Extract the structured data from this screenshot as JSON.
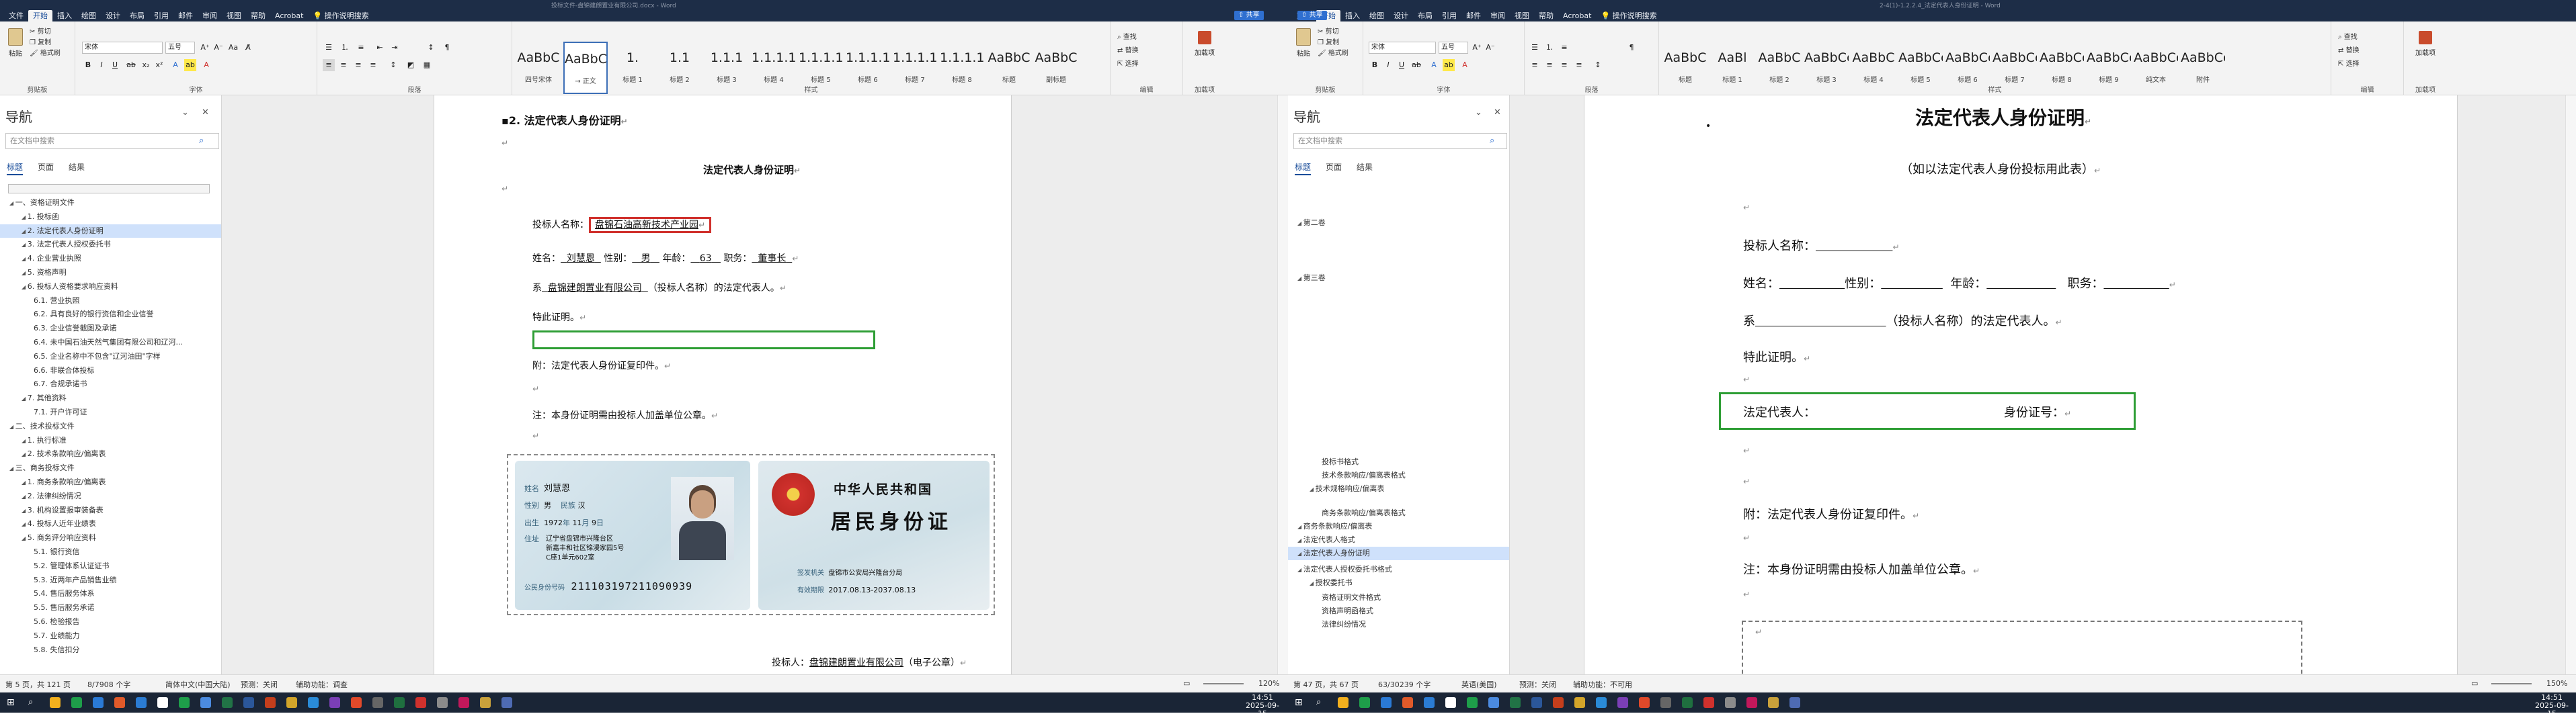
{
  "left_window": {
    "title_text": "投标文件-盘锦建朗置业有限公司.docx  -  Word",
    "ribbon_tabs": [
      "文件",
      "开始",
      "插入",
      "绘图",
      "设计",
      "布局",
      "引用",
      "邮件",
      "审阅",
      "视图",
      "帮助",
      "Acrobat",
      "操作说明搜索"
    ],
    "share_label": "共享",
    "ribbon": {
      "clipboard": {
        "paste": "粘贴",
        "cut": "剪切",
        "copy": "复制",
        "format_painter": "格式刷",
        "group": "剪贴板"
      },
      "font": {
        "name": "宋体",
        "size": "五号",
        "group": "字体"
      },
      "paragraph": {
        "group": "段落"
      },
      "styles": {
        "group": "样式",
        "items": [
          {
            "preview": "AaBbC",
            "name": "四号宋体"
          },
          {
            "preview": "AaBbCcD",
            "name": "→ 正文"
          },
          {
            "preview": "1.",
            "name": "标题 1"
          },
          {
            "preview": "1.1",
            "name": "标题 2"
          },
          {
            "preview": "1.1.1",
            "name": "标题 3"
          },
          {
            "preview": "1.1.1.1",
            "name": "标题 4"
          },
          {
            "preview": "1.1.1.1.1",
            "name": "标题 5"
          },
          {
            "preview": "1.1.1.1.1.",
            "name": "标题 6"
          },
          {
            "preview": "1.1.1.1.1",
            "name": "标题 7"
          },
          {
            "preview": "1.1.1.1.",
            "name": "标题 8"
          },
          {
            "preview": "AaBbC",
            "name": "标题"
          },
          {
            "preview": "AaBbC",
            "name": "副标题"
          }
        ]
      },
      "editing": {
        "find": "查找",
        "replace": "替换",
        "select": "选择",
        "group": "编辑"
      },
      "addins": {
        "label": "加载项",
        "group": "加载项"
      }
    },
    "nav": {
      "title": "导航",
      "search_placeholder": "在文档中搜索",
      "tabs": [
        "标题",
        "页面",
        "结果"
      ],
      "items": [
        {
          "text": "一、资格证明文件",
          "level": 0
        },
        {
          "text": "1. 投标函",
          "level": 1
        },
        {
          "text": "2. 法定代表人身份证明",
          "level": 1,
          "selected": true
        },
        {
          "text": "3. 法定代表人授权委托书",
          "level": 1
        },
        {
          "text": "4. 企业营业执照",
          "level": 1
        },
        {
          "text": "5. 资格声明",
          "level": 1
        },
        {
          "text": "6. 投标人资格要求响应资料",
          "level": 1
        },
        {
          "text": "6.1. 营业执照",
          "level": 2
        },
        {
          "text": "6.2. 具有良好的银行资信和企业信誉",
          "level": 2
        },
        {
          "text": "6.3. 企业信誉截图及承诺",
          "level": 2
        },
        {
          "text": "6.4. 未中国石油天然气集团有限公司和辽河...",
          "level": 2
        },
        {
          "text": "6.5. 企业名称中不包含\"辽河油田\"字样",
          "level": 2
        },
        {
          "text": "6.6. 非联合体投标",
          "level": 2
        },
        {
          "text": "6.7. 合规承诺书",
          "level": 2
        },
        {
          "text": "7. 其他资料",
          "level": 1
        },
        {
          "text": "7.1. 开户许可证",
          "level": 2
        },
        {
          "text": "二、技术投标文件",
          "level": 0
        },
        {
          "text": "1. 执行标准",
          "level": 1
        },
        {
          "text": "2. 技术条款响应/偏离表",
          "level": 1
        },
        {
          "text": "三、商务投标文件",
          "level": 0
        },
        {
          "text": "1. 商务条款响应/偏离表",
          "level": 1
        },
        {
          "text": "2. 法律纠纷情况",
          "level": 1
        },
        {
          "text": "3. 机构设置报审装备表",
          "level": 1
        },
        {
          "text": "4. 投标人近年业绩表",
          "level": 1
        },
        {
          "text": "5. 商务评分响应资料",
          "level": 1
        },
        {
          "text": "5.1. 银行资信",
          "level": 2
        },
        {
          "text": "5.2. 管理体系认证证书",
          "level": 2
        },
        {
          "text": "5.3. 近两年产品销售业绩",
          "level": 2
        },
        {
          "text": "5.4. 售后服务体系",
          "level": 2
        },
        {
          "text": "5.5. 售后服务承诺",
          "level": 2
        },
        {
          "text": "5.6. 检验报告",
          "level": 2
        },
        {
          "text": "5.7. 业绩能力",
          "level": 2
        },
        {
          "text": "5.8. 失信扣分",
          "level": 2
        }
      ]
    },
    "doc": {
      "heading": "2. 法定代表人身份证明",
      "title": "法定代表人身份证明",
      "bidder_label": "投标人名称：",
      "bidder_value": "盘锦石油高新技术产业园",
      "name_label": "姓名：",
      "name_value": "刘慧恩",
      "gender_label": "性别：",
      "gender_value": "男",
      "age_label": "年龄：",
      "age_value": "63",
      "position_label": "职务：",
      "position_value": "董事长",
      "of_prefix": "系",
      "company_value": "盘锦建朗置业有限公司",
      "of_suffix": "（投标人名称）的法定代表人。",
      "certify": "特此证明。",
      "attachment": "附：法定代表人身份证复印件。",
      "note": "注：本身份证明需由投标人加盖单位公章。",
      "signature_label": "投标人：",
      "signature_value": "盘锦建朗置业有限公司",
      "signature_suffix": "（电子公章）"
    },
    "id_card": {
      "front": {
        "name_label": "姓名",
        "name": "刘慧恩",
        "gender_label": "性别",
        "gender": "男",
        "ethnic_label": "民族",
        "ethnic": "汉",
        "birth_label": "出生",
        "birth_year": "1972",
        "birth_month": "11",
        "birth_day": "9",
        "year_unit": "年",
        "month_unit": "月",
        "day_unit": "日",
        "address_label": "住址",
        "address_l1": "辽宁省盘锦市兴隆台区",
        "address_l2": "新嘉丰和社区锦漫家园5号",
        "address_l3": "C座1单元602室",
        "id_label": "公民身份号码",
        "id_number": "211103197211090939"
      },
      "back": {
        "country": "中华人民共和国",
        "card_title": "居民身份证",
        "authority_label": "签发机关",
        "authority": "盘锦市公安局兴隆台分局",
        "valid_label": "有效期限",
        "valid": "2017.08.13-2037.08.13"
      }
    },
    "status": {
      "page": "第 5 页，共 121 页",
      "words": "8/7908 个字",
      "lang": "简体中文(中国大陆)",
      "predict": "预测：关闭",
      "accessibility": "辅助功能：调查",
      "zoom": "120%"
    }
  },
  "right_window": {
    "title_text": "2-4(1)-1.2.2.4_法定代表人身份证明  -  Word",
    "ribbon_tabs": [
      "文件",
      "开始",
      "插入",
      "绘图",
      "设计",
      "布局",
      "引用",
      "邮件",
      "审阅",
      "视图",
      "帮助",
      "Acrobat",
      "操作说明搜索"
    ],
    "share_label": "共享",
    "ribbon": {
      "clipboard": {
        "paste": "粘贴",
        "cut": "剪切",
        "copy": "复制",
        "format_painter": "格式刷",
        "group": "剪贴板"
      },
      "font": {
        "name": "宋体",
        "size": "五号",
        "group": "字体"
      },
      "paragraph": {
        "group": "段落"
      },
      "styles": {
        "group": "样式",
        "items": [
          {
            "preview": "AaBbC",
            "name": "标题"
          },
          {
            "preview": "AaBl",
            "name": "标题 1"
          },
          {
            "preview": "AaBbC",
            "name": "标题 2"
          },
          {
            "preview": "AaBbCcI",
            "name": "标题 3"
          },
          {
            "preview": "AaBbC",
            "name": "标题 4"
          },
          {
            "preview": "AaBbCcD",
            "name": "标题 5"
          },
          {
            "preview": "AaBbCcDd",
            "name": "标题 6"
          },
          {
            "preview": "AaBbCcDd",
            "name": "标题 7"
          },
          {
            "preview": "AaBbCcDd",
            "name": "标题 8"
          },
          {
            "preview": "AaBbCcDd",
            "name": "标题 9"
          },
          {
            "preview": "AaBbCcDd",
            "name": "纯文本"
          },
          {
            "preview": "AaBbCc",
            "name": "附件"
          }
        ]
      },
      "editing": {
        "find": "查找",
        "replace": "替换",
        "select": "选择",
        "group": "编辑"
      },
      "addins": {
        "label": "加载项",
        "group": "加载项"
      }
    },
    "nav": {
      "title": "导航",
      "search_placeholder": "在文档中搜索",
      "tabs": [
        "标题",
        "页面",
        "结果"
      ],
      "items": [
        {
          "text": "第二卷",
          "level": 0
        },
        {
          "text": "第三卷",
          "level": 0
        },
        {
          "text": "投标书格式",
          "level": 2
        },
        {
          "text": "技术条款响应/偏离表格式",
          "level": 2
        },
        {
          "text": "技术规格响应/偏离表",
          "level": 1
        },
        {
          "text": "商务条款响应/偏离表格式",
          "level": 2
        },
        {
          "text": "商务条款响应/偏离表",
          "level": 0
        },
        {
          "text": "法定代表人格式",
          "level": 0
        },
        {
          "text": "法定代表人身份证明",
          "level": 0,
          "selected": true
        },
        {
          "text": "法定代表人授权委托书格式",
          "level": 0
        },
        {
          "text": "授权委托书",
          "level": 1
        },
        {
          "text": "资格证明文件格式",
          "level": 2
        },
        {
          "text": "资格声明函格式",
          "level": 2
        },
        {
          "text": "法律纠纷情况",
          "level": 2
        }
      ]
    },
    "doc": {
      "title": "法定代表人身份证明",
      "subtitle": "（如以法定代表人身份投标用此表）",
      "bidder_label": "投标人名称：",
      "name_label": "姓名：",
      "gender_label": "性别：",
      "age_label": "年龄：",
      "position_label": "职务：",
      "of_prefix": "系",
      "of_suffix": "（投标人名称）的法定代表人。",
      "certify": "特此证明。",
      "rep_label": "法定代表人：",
      "id_label": "身份证号：",
      "attachment": "附：法定代表人身份证复印件。",
      "note": "注：本身份证明需由投标人加盖单位公章。"
    },
    "status": {
      "page": "第 47 页，共 67 页",
      "words": "63/30239 个字",
      "lang": "英语(美国)",
      "predict": "预测：关闭",
      "accessibility": "辅助功能：不可用",
      "zoom": "150%"
    }
  },
  "taskbar": {
    "left_time": "14:51",
    "left_date": "2025-09-15",
    "right_time": "14:51",
    "right_date": "2025-09-15"
  },
  "colors": {
    "titlebar": "#1d2d47",
    "taskbar": "#1a2536",
    "accent": "#2f6fd0",
    "nav_selected": "#cfe1fb",
    "red_box": "#d0312d",
    "green_box": "#2e9e35"
  }
}
